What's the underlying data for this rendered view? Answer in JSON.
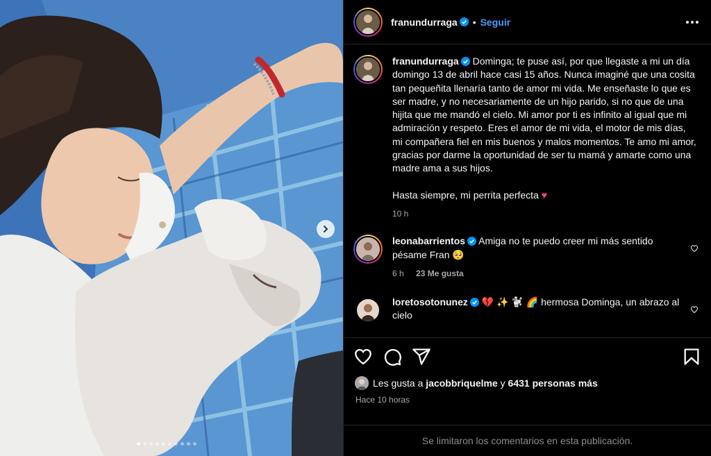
{
  "post": {
    "author": "franundurraga",
    "follow_label": "Seguir",
    "separator": "•",
    "carousel": {
      "total_slides": 10,
      "active_index": 0
    }
  },
  "caption": {
    "username": "franundurraga",
    "text": "Dominga; te puse así, por que llegaste a mi un día domingo 13 de abril hace casi 15 años. Nunca imaginé que una cosita tan pequeñita llenaría tanto de amor mi vida. Me enseñaste lo que es ser madre, y no necesariamente de un hijo parido, si no que de una hijita que me mandó el cielo. Mi amor por ti es infinito al igual que mi admiración y respeto. Eres el amor de mi vida, el motor de mis días, mi compañera fiel en mis buenos y malos momentos. Te amo mi amor, gracias por darme la oportunidad de ser tu mamá y amarte como una madre ama a sus hijos.",
    "closing": "Hasta siempre, mi perrita perfecta",
    "closing_emoji": "♥",
    "time": "10 h"
  },
  "comments": [
    {
      "username": "leonabarrientos",
      "text": "Amiga no te puedo creer mi más sentido pésame Fran",
      "emoji": "🥺",
      "time": "6 h",
      "likes": "23 Me gusta"
    },
    {
      "username": "loretosotonunez",
      "text": "💔 ✨ 🐩 🌈  hermosa Dominga, un abrazo al cielo"
    }
  ],
  "likes_line": {
    "prefix": "Les gusta a",
    "user": "jacobbriquelme",
    "connector": "y",
    "others": "6431 personas más"
  },
  "posted_time": "Hace 10 horas",
  "footer_text": "Se limitaron los comentarios en esta publicación.",
  "colors": {
    "follow": "#4a9eff",
    "verified": "#0095f6",
    "background": "#000000",
    "muted": "#a8a8a8"
  }
}
